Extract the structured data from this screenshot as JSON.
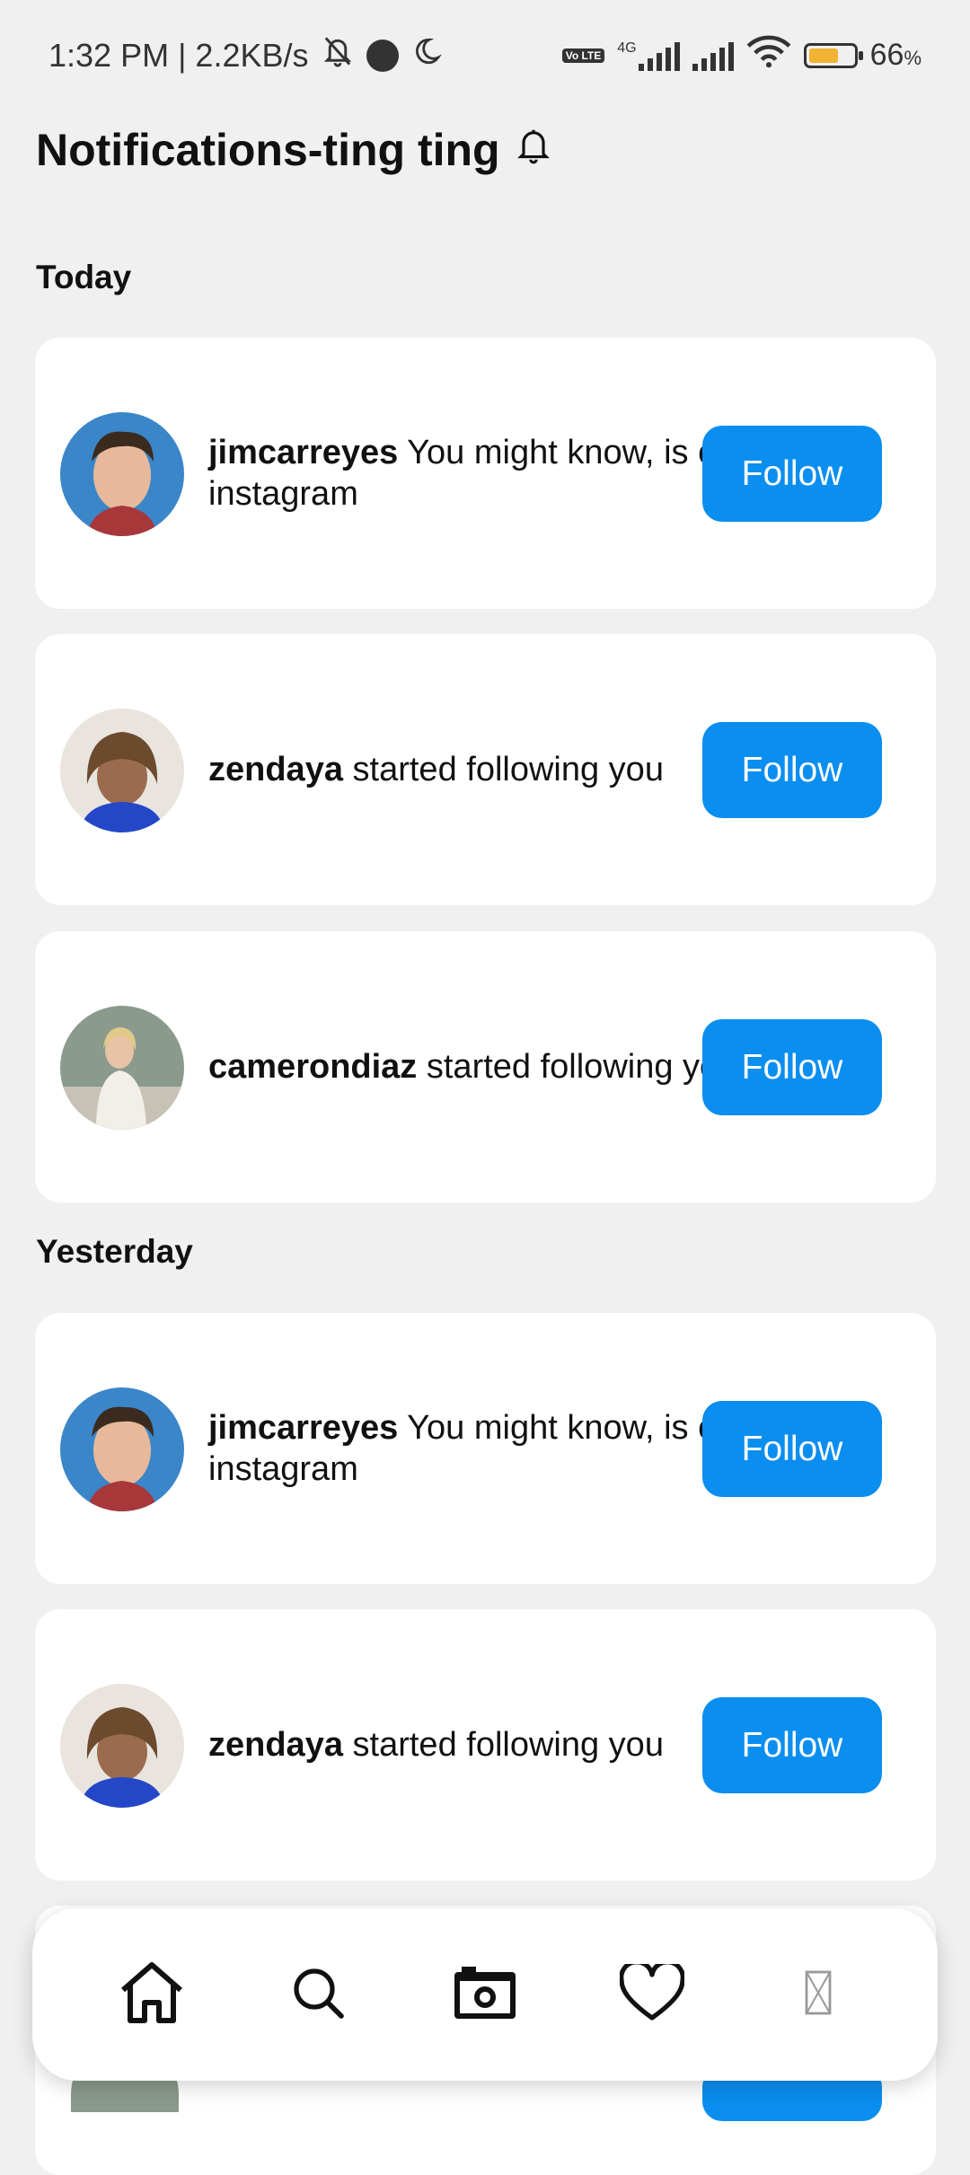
{
  "status_bar": {
    "time_speed": "1:32 PM | 2.2KB/s",
    "network_4g": "4G",
    "volte": "Vo LTE",
    "battery_percent": "66",
    "battery_unit": "%",
    "battery_level": 0.66
  },
  "header": {
    "title": "Notifications-ting ting",
    "icon": "bell-icon"
  },
  "sections": [
    {
      "label": "Today",
      "items": [
        {
          "username": "jimcarreyes",
          "message": "You might know, is on instagram",
          "button": "Follow",
          "avatar": "avatar-jimcarreyes"
        },
        {
          "username": "zendaya",
          "message": "started following you",
          "button": "Follow",
          "avatar": "avatar-zendaya"
        },
        {
          "username": "camerondiaz",
          "message": "started following you",
          "button": "Follow",
          "avatar": "avatar-camerondiaz"
        }
      ]
    },
    {
      "label": "Yesterday",
      "items": [
        {
          "username": "jimcarreyes",
          "message": "You might know, is on instagram",
          "button": "Follow",
          "avatar": "avatar-jimcarreyes"
        },
        {
          "username": "zendaya",
          "message": "started following you",
          "button": "Follow",
          "avatar": "avatar-zendaya"
        }
      ]
    }
  ],
  "bottom_nav": {
    "items": [
      "home-icon",
      "search-icon",
      "camera-icon",
      "heart-icon",
      "broken-image-icon"
    ]
  },
  "colors": {
    "accent": "#0a8ef0",
    "background": "#f0f0f0",
    "card": "#ffffff"
  }
}
